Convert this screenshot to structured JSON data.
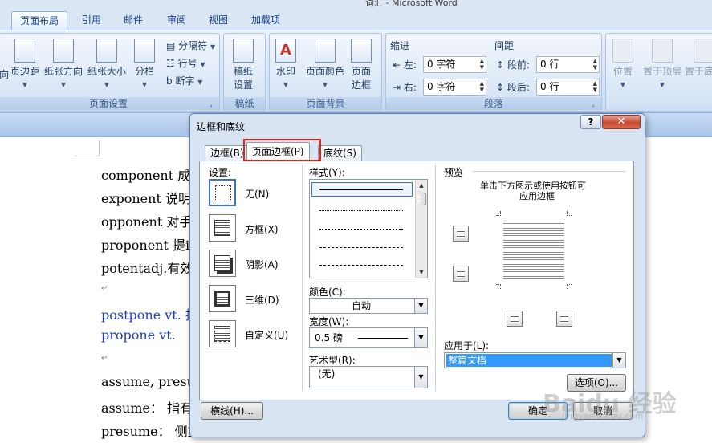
{
  "app": {
    "window_title": "词汇 - Microsoft Word"
  },
  "ribbon": {
    "tabs": [
      {
        "label": "页面布局",
        "active": true
      },
      {
        "label": "引用"
      },
      {
        "label": "邮件"
      },
      {
        "label": "审阅"
      },
      {
        "label": "视图"
      },
      {
        "label": "加载项"
      }
    ],
    "page_setup": {
      "truncated": "向",
      "margins": "页边距",
      "orientation": "纸张方向",
      "size": "纸张大小",
      "columns": "分栏",
      "breaks": "分隔符",
      "line_numbers": "行号",
      "hyphenation": "断字",
      "group_label": "页面设置"
    },
    "manuscript": {
      "button_line1": "稿纸",
      "button_line2": "设置",
      "group_label": "稿纸"
    },
    "page_background": {
      "watermark": "水印",
      "page_color": "页面颜色",
      "borders_line1": "页面",
      "borders_line2": "边框",
      "group_label": "页面背景"
    },
    "paragraph": {
      "indent_label": "缩进",
      "left_label": "左:",
      "left_value": "0 字符",
      "right_label": "右:",
      "right_value": "0 字符",
      "spacing_label": "间距",
      "before_label": "段前:",
      "before_value": "0 行",
      "after_label": "段后:",
      "after_value": "0 行",
      "group_label": "段落"
    },
    "arrange": {
      "position": "位置",
      "bring_front": "置于顶层",
      "send_back": "置于底层"
    }
  },
  "document": {
    "lines": [
      "component 成",
      "exponent 说明",
      "opponent 对手",
      "proponent 提i",
      "potentadj.有效",
      "postpone vt. 推",
      "propone  vt. ",
      "assume, presu",
      "assume： 指有",
      "presume： 侧重以过去经验或根据现实的某些想象把未事认定为是事实。"
    ],
    "paragraph_mark": "↵"
  },
  "dialog": {
    "title": "边框和底纹",
    "help": "?",
    "close": "✕",
    "tabs": [
      "边框(B)",
      "页面边框(P)",
      "底纹(S)"
    ],
    "setting_label": "设置:",
    "settings": [
      "无(N)",
      "方框(X)",
      "阴影(A)",
      "三维(D)",
      "自定义(U)"
    ],
    "style_label": "样式(Y):",
    "color_label": "颜色(C):",
    "color_value": "自动",
    "width_label": "宽度(W):",
    "width_value": "0.5 磅",
    "art_label": "艺术型(R):",
    "art_value": "(无)",
    "preview_label": "预览",
    "preview_hint_line1": "单击下方图示或使用按钮可",
    "preview_hint_line2": "应用边框",
    "apply_label": "应用于(L):",
    "apply_value": "整篇文档",
    "options_button": "选项(O)...",
    "horizontal_line_button": "横线(H)...",
    "ok_button": "确定",
    "cancel_button": "取消"
  },
  "watermark_text": "Baidu 经验",
  "watermark_sub": "jingyan.baidu.com"
}
